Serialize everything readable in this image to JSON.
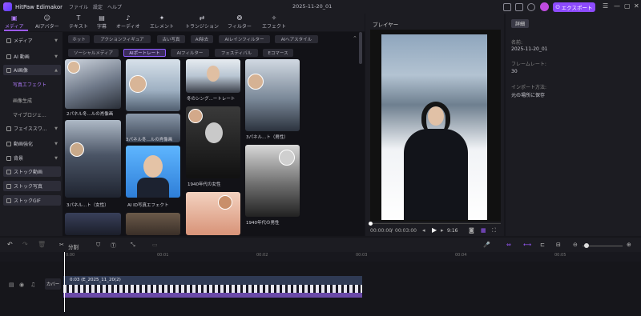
{
  "app": {
    "name": "HitPaw Edimakor",
    "project_title": "2025-11-20_01",
    "export_label": "エクスポート"
  },
  "menu": [
    "ファイル",
    "設定",
    "ヘルプ"
  ],
  "toolbar": {
    "tools": [
      {
        "label": "メディア",
        "icon": "media-icon",
        "glyph": "▣"
      },
      {
        "label": "AIアバター",
        "icon": "avatar-icon",
        "glyph": "☺"
      },
      {
        "label": "テキスト",
        "icon": "text-icon",
        "glyph": "T"
      },
      {
        "label": "字幕",
        "icon": "subtitle-icon",
        "glyph": "▤"
      },
      {
        "label": "オーディオ",
        "icon": "audio-icon",
        "glyph": "♪"
      },
      {
        "label": "エレメント",
        "icon": "element-icon",
        "glyph": "✦"
      },
      {
        "label": "トランジション",
        "icon": "transition-icon",
        "glyph": "⇄"
      },
      {
        "label": "フィルター",
        "icon": "filter-icon",
        "glyph": "❂"
      },
      {
        "label": "エフェクト",
        "icon": "effect-icon",
        "glyph": "✧"
      }
    ]
  },
  "sidebar": {
    "items": [
      {
        "label": "メディア"
      },
      {
        "label": "AI 動画"
      },
      {
        "label": "AI画像"
      },
      {
        "label": "写真エフェクト"
      },
      {
        "label": "画像生成"
      },
      {
        "label": "マイプロジェ..."
      },
      {
        "label": "フェイススワ..."
      },
      {
        "label": "動画強化"
      },
      {
        "label": "背景"
      },
      {
        "label": "ストック動画"
      },
      {
        "label": "ストック写真"
      },
      {
        "label": "ストックGIF"
      }
    ]
  },
  "filters": {
    "row1": [
      "ホット",
      "アクションフィギュア",
      "古い写真",
      "AI除去",
      "AIレインフィルター",
      "AIヘアスタイル"
    ],
    "row2": [
      "ソーシャルメディア",
      "AIポートレート",
      "AIフィルター",
      "フェスティバル",
      "Eコマース"
    ]
  },
  "cards": [
    "2パネル冬...ルの肖像画",
    "冬のシング...ートレート",
    "3パネル...ト（男性）",
    "3パネル冬...ルの肖像画",
    "1940年代の女性",
    "3パネル...ト（女性）",
    "AI ID写真エフェクト",
    "1940年代の男性"
  ],
  "player": {
    "label": "プレイヤー",
    "current": "00:00:00",
    "total": "00:03:00",
    "ratio": "9:16",
    "progress": 0.0
  },
  "details": {
    "tab": "詳細",
    "fields": [
      {
        "label": "名前:",
        "value": "2025-11-20_01"
      },
      {
        "label": "フレームレート:",
        "value": "30"
      },
      {
        "label": "インポート方法:",
        "value": "元の場所に保存"
      }
    ]
  },
  "timeline": {
    "split_label": "分割",
    "ruler": [
      "0:00",
      "00:01",
      "00:02",
      "00:03",
      "00:04",
      "00:05"
    ],
    "cover_label": "カバー",
    "clip_label": "0:03 (E_2025_11_20(2)"
  },
  "colors": {
    "accent": "#9b59ff",
    "export": "#8d4bff"
  }
}
